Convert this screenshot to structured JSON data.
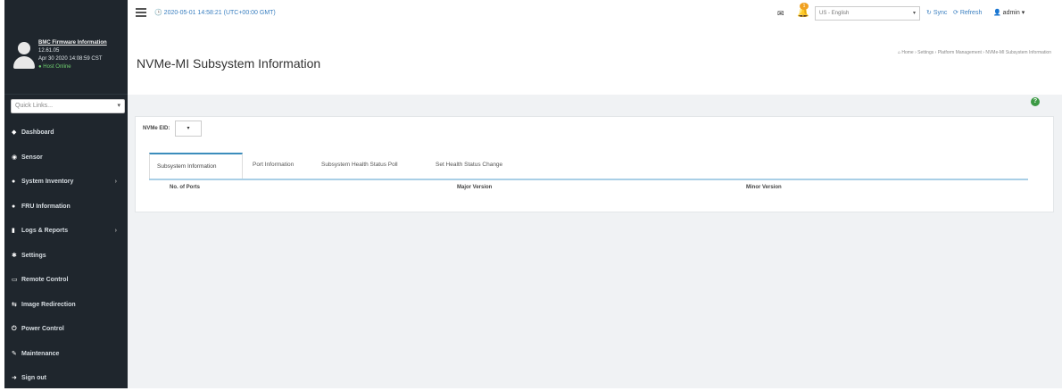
{
  "sidebar": {
    "user": {
      "title": "BMC Firmware Information",
      "version": "12.61.05",
      "build_date": "Apr 30 2020 14:08:59 CST",
      "status": "Host Online"
    },
    "quick_links": "Quick Links...",
    "menu": [
      {
        "label": "Dashboard",
        "icon": "dashboard-icon",
        "glyph": "◆",
        "has_submenu": false
      },
      {
        "label": "Sensor",
        "icon": "sensor-icon",
        "glyph": "◉",
        "has_submenu": false
      },
      {
        "label": "System Inventory",
        "icon": "inventory-icon",
        "glyph": "●",
        "has_submenu": true
      },
      {
        "label": "FRU Information",
        "icon": "info-icon",
        "glyph": "●",
        "has_submenu": false
      },
      {
        "label": "Logs & Reports",
        "icon": "chart-icon",
        "glyph": "▮",
        "has_submenu": true
      },
      {
        "label": "Settings",
        "icon": "gear-icon",
        "glyph": "✱",
        "has_submenu": false
      },
      {
        "label": "Remote Control",
        "icon": "monitor-icon",
        "glyph": "▭",
        "has_submenu": false
      },
      {
        "label": "Image Redirection",
        "icon": "image-icon",
        "glyph": "⇆",
        "has_submenu": false
      },
      {
        "label": "Power Control",
        "icon": "power-icon",
        "glyph": "⏻",
        "has_submenu": false
      },
      {
        "label": "Maintenance",
        "icon": "wrench-icon",
        "glyph": "✎",
        "has_submenu": false
      },
      {
        "label": "Sign out",
        "icon": "sign-out-icon",
        "glyph": "➜",
        "has_submenu": false
      }
    ]
  },
  "topbar": {
    "datetime": "2020-05-01 14:58:21 (UTC+00:00 GMT)",
    "notification_count": "1",
    "language": "US - English",
    "sync_label": "Sync",
    "refresh_label": "Refresh",
    "user_label": "admin"
  },
  "page": {
    "title": "NVMe-MI Subsystem Information",
    "breadcrumb": [
      "Home",
      "Settings",
      "Platform Management",
      "NVMe-MI Subsystem Information"
    ]
  },
  "controls": {
    "nvme_eid_label": "NVMe EID:",
    "nvme_eid_value": "▾"
  },
  "tabs": [
    {
      "label": "Subsystem Information",
      "active": true
    },
    {
      "label": "Port Information",
      "active": false
    },
    {
      "label": "Subsystem Health Status Poll",
      "active": false
    },
    {
      "label": "Set Health Status Change",
      "active": false
    }
  ],
  "table": {
    "columns": [
      "No. of Ports",
      "Major Version",
      "Minor Version"
    ]
  },
  "colors": {
    "sidebar_bg": "#1f262d",
    "accent": "#3c8dbc",
    "help": "#3c9a44"
  }
}
